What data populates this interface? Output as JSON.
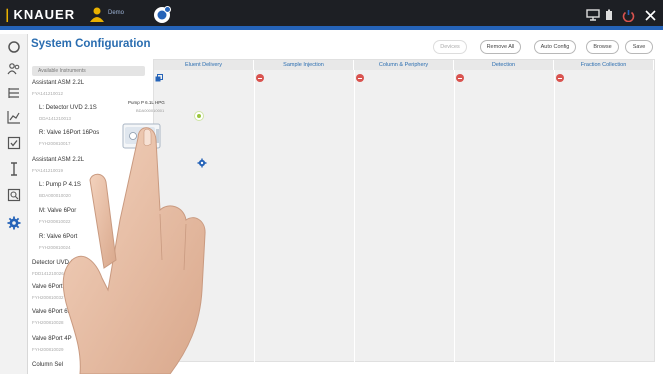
{
  "topbar": {
    "brand": "KNAUER",
    "user_label": "Demo"
  },
  "page": {
    "title": "System Configuration"
  },
  "toolbar": {
    "buttons": [
      {
        "label": "Devices",
        "disabled": true
      },
      {
        "label": "Remove All",
        "disabled": false
      },
      {
        "label": "Auto Config",
        "disabled": false
      },
      {
        "label": "Browse",
        "disabled": false
      },
      {
        "label": "Save",
        "disabled": false
      }
    ]
  },
  "available": {
    "header": "Available Instruments",
    "items": [
      {
        "name": "Assistant ASM 2.2L",
        "serial": "FYA141210012",
        "indent": false
      },
      {
        "name": "L: Detector UVD 2.1S",
        "serial": "DDA141210013",
        "indent": true
      },
      {
        "name": "R: Valve 16Port 16Pos",
        "serial": "FYH200810017",
        "indent": true
      },
      {
        "name": "Assistant ASM 2.2L",
        "serial": "FYA141210019",
        "indent": false
      },
      {
        "name": "L: Pump P 4.1S",
        "serial": "BDA000010020",
        "indent": true
      },
      {
        "name": "M: Valve 6Por",
        "serial": "FYH200810022",
        "indent": true
      },
      {
        "name": "R: Valve 6Port",
        "serial": "FYH200810024",
        "indent": true
      },
      {
        "name": "Detector UVD 2.",
        "serial": "FDD141210026",
        "indent": false
      },
      {
        "name": "Valve 6Port 2P",
        "serial": "FYH200810032",
        "indent": false
      },
      {
        "name": "Valve 6Port 6P",
        "serial": "FYH200810028",
        "indent": false
      },
      {
        "name": "Valve 8Port 4P",
        "serial": "FYH200810029",
        "indent": false
      },
      {
        "name": "Column Sel",
        "serial": "",
        "indent": false
      }
    ]
  },
  "columns": [
    "Eluent Delivery",
    "Sample Injection",
    "Column & Periphery",
    "Detection",
    "Fraction Collection"
  ],
  "dragged_device": {
    "name": "Pump P 6.1L HPG",
    "serial": "BDA000010001"
  },
  "colors": {
    "accent": "#2a6db0",
    "topbar": "#1d1f24",
    "remove": "#d9534f",
    "ok": "#9ac53f"
  }
}
